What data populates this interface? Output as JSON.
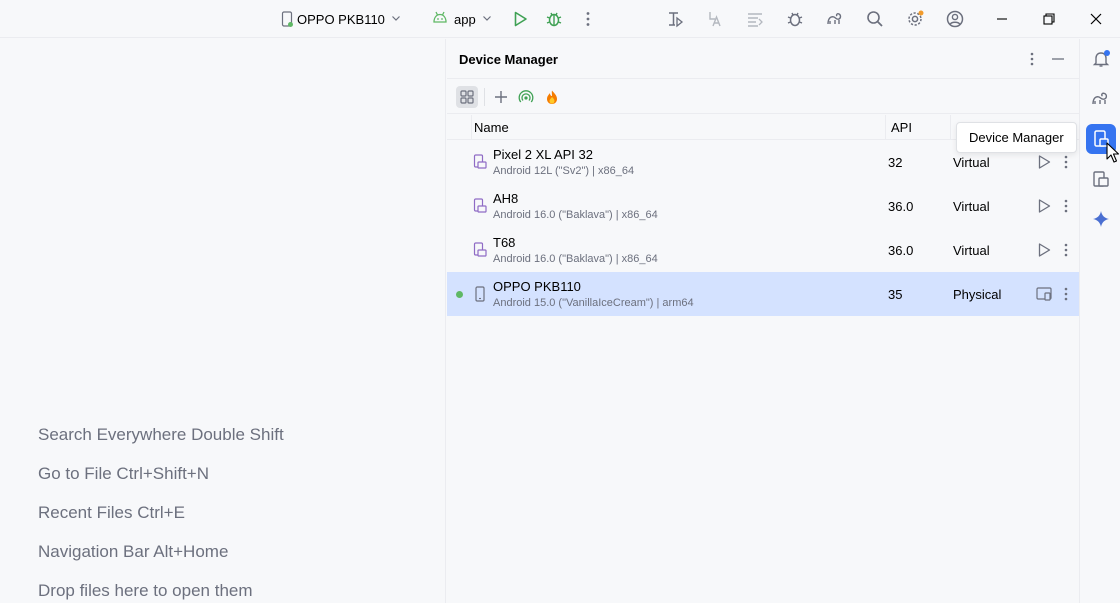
{
  "toolbar": {
    "device_selector": "OPPO PKB110",
    "run_config": "app",
    "icons": [
      "phone-icon",
      "chevron-down-icon",
      "android-icon",
      "run-icon",
      "debug-icon",
      "more-icon",
      "profiler-icon",
      "translate-icon",
      "logcat-icon",
      "bug-icon",
      "gradle-icon",
      "search-icon",
      "settings-icon",
      "account-icon",
      "minimize-icon",
      "restore-icon",
      "close-icon"
    ]
  },
  "editor": {
    "hints": [
      "Search Everywhere Double Shift",
      "Go to File Ctrl+Shift+N",
      "Recent Files Ctrl+E",
      "Navigation Bar Alt+Home",
      "Drop files here to open them"
    ]
  },
  "device_manager": {
    "title": "Device Manager",
    "columns": {
      "name": "Name",
      "api": "API"
    },
    "devices": [
      {
        "name": "Pixel 2 XL API 32",
        "sub": "Android 12L (\"Sv2\") | x86_64",
        "api": "32",
        "type": "Virtual",
        "selected": false,
        "online": false
      },
      {
        "name": "AH8",
        "sub": "Android 16.0 (\"Baklava\") | x86_64",
        "api": "36.0",
        "type": "Virtual",
        "selected": false,
        "online": false
      },
      {
        "name": "T68",
        "sub": "Android 16.0 (\"Baklava\") | x86_64",
        "api": "36.0",
        "type": "Virtual",
        "selected": false,
        "online": false
      },
      {
        "name": "OPPO PKB110",
        "sub": "Android 15.0 (\"VanillaIceCream\") | arm64",
        "api": "35",
        "type": "Physical",
        "selected": true,
        "online": true
      }
    ]
  },
  "tooltip": "Device Manager",
  "colors": {
    "accent": "#3574f0",
    "selection": "#d4e2ff",
    "online": "#5fb865",
    "hint_text": "#6c707e"
  }
}
